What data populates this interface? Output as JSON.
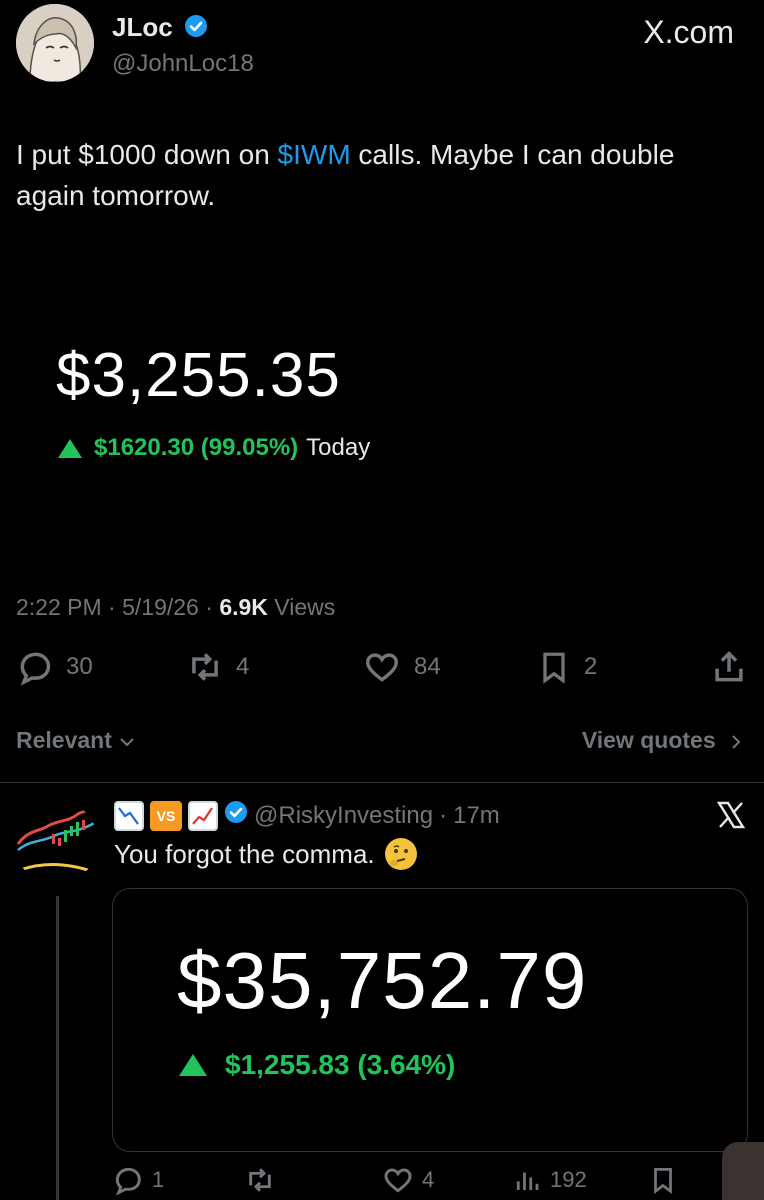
{
  "tweet": {
    "display_name": "JLoc",
    "handle": "@JohnLoc18",
    "site_label": "X.com",
    "text_before": "I put $1000 down on ",
    "cashtag": "$IWM",
    "text_after": " calls. Maybe I can double again tomorrow.",
    "balance": "$3,255.35",
    "gain": "$1620.30 (99.05%)",
    "gain_period": "Today",
    "time": "2:22 PM",
    "sep1": " · ",
    "date": "5/19/26",
    "sep2": " · ",
    "views_count": "6.9K",
    "views_label": " Views",
    "replies": "30",
    "reposts": "4",
    "likes": "84",
    "bookmarks": "2"
  },
  "sort": {
    "relevant_label": "Relevant",
    "view_quotes_label": "View quotes"
  },
  "reply": {
    "vs_label": "VS",
    "handle": "@RiskyInvesting",
    "dot": " · ",
    "age": "17m",
    "text": "You forgot the comma.",
    "balance": "$35,752.79",
    "gain": "$1,255.83 (3.64%)",
    "replies": "1",
    "reposts": "",
    "likes": "4",
    "views": "192"
  },
  "colors": {
    "accent": "#1d9bf0",
    "gain_green": "#21c35a",
    "muted": "#71767b"
  }
}
